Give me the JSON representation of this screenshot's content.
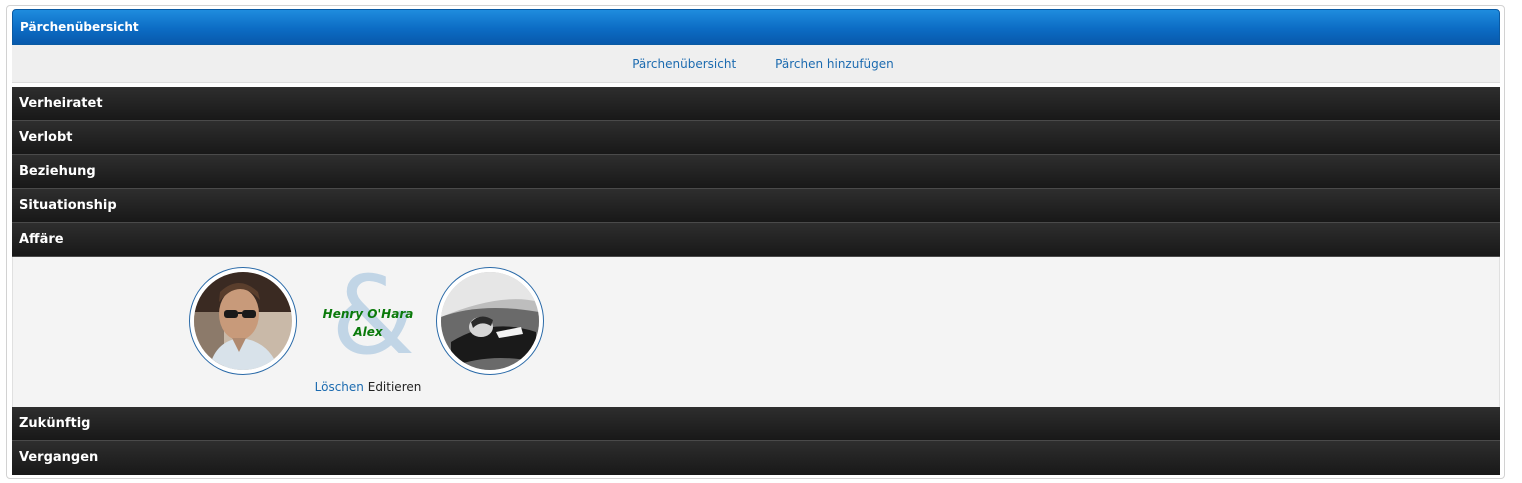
{
  "title": "Pärchenübersicht",
  "nav": {
    "overview": "Pärchenübersicht",
    "add": "Pärchen hinzufügen"
  },
  "categories": {
    "married": "Verheiratet",
    "engaged": "Verlobt",
    "relationship": "Beziehung",
    "situationship": "Situationship",
    "affair": "Affäre",
    "future": "Zukünftig",
    "past": "Vergangen"
  },
  "couple": {
    "name1": "Henry O'Hara",
    "name2": "Alex",
    "ampersand": "&",
    "delete_label": "Löschen",
    "edit_label": "Editieren"
  },
  "colors": {
    "header_blue": "#0c6cc4",
    "category_dark": "#1e1e1e",
    "link": "#1c6bb0",
    "name_green": "#0a7a0a"
  }
}
